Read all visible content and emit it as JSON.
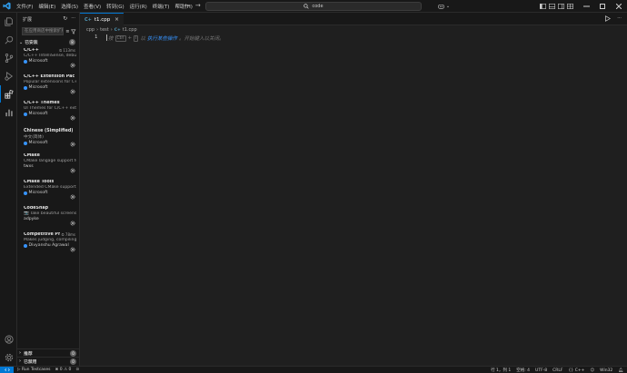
{
  "titlebar": {
    "menu": [
      "文件(F)",
      "编辑(E)",
      "选择(S)",
      "查看(V)",
      "转到(G)",
      "运行(R)",
      "终端(T)",
      "帮助(H)"
    ],
    "search_text": "code"
  },
  "sidebar": {
    "title": "扩展",
    "search_placeholder": "在应用商店中搜索扩展",
    "installed_label": "已安装",
    "installed_count": "8",
    "extensions": [
      {
        "name": "C/C++",
        "desc": "C/C++ IntelliSense, debugging, and code browsing.",
        "publisher": "Microsoft",
        "verified": true,
        "timing": "113ms"
      },
      {
        "name": "C/C++ Extension Pack",
        "desc": "Popular extensions for C++ development in Visual Studio Code.",
        "publisher": "Microsoft",
        "verified": true,
        "timing": ""
      },
      {
        "name": "C/C++ Themes",
        "desc": "UI Themes for C/C++ extension.",
        "publisher": "Microsoft",
        "verified": true,
        "timing": ""
      },
      {
        "name": "Chinese (Simplified) (简体中文)",
        "desc": "中文(简体)",
        "publisher": "Microsoft",
        "verified": true,
        "timing": ""
      },
      {
        "name": "CMake",
        "desc": "CMake langage support for Visual Studio Code",
        "publisher": "twxs",
        "verified": false,
        "timing": ""
      },
      {
        "name": "CMake Tools",
        "desc": "Extended CMake support in Visual Studio Code",
        "publisher": "Microsoft",
        "verified": true,
        "timing": ""
      },
      {
        "name": "CodeSnap",
        "desc": "📷 Take beautiful screenshots of your code",
        "publisher": "adpyke",
        "verified": false,
        "timing": ""
      },
      {
        "name": "Competitive Programming Helper (cph)",
        "desc": "Makes judging, compiling, and downloading problems easy.",
        "publisher": "Divyanshu Agrawal",
        "verified": true,
        "timing": "78ms"
      }
    ],
    "recommended_label": "推荐",
    "recommended_count": "0",
    "disabled_label": "已禁用",
    "disabled_count": "0"
  },
  "editor": {
    "tab_label": "t1.cpp",
    "breadcrumb": [
      "cpp",
      "test",
      "t1.cpp"
    ],
    "line_number": "1",
    "hint": {
      "press": "按",
      "key1": "Ctrl",
      "plus": "+",
      "key2": "I",
      "ask": "以",
      "link": "执行某些操作",
      "rest": "。开始键入以关闭。"
    }
  },
  "statusbar": {
    "run_testcases": "Run Testcases",
    "errors": "0",
    "warnings": "0",
    "position": "行 1，列 1",
    "spaces": "空格: 4",
    "encoding": "UTF-8",
    "eol": "CRLF",
    "language": "C++",
    "platform": "Win32"
  },
  "colors": {
    "accent": "#0078d4",
    "background": "#1f1f1f",
    "sidebar": "#181818"
  }
}
